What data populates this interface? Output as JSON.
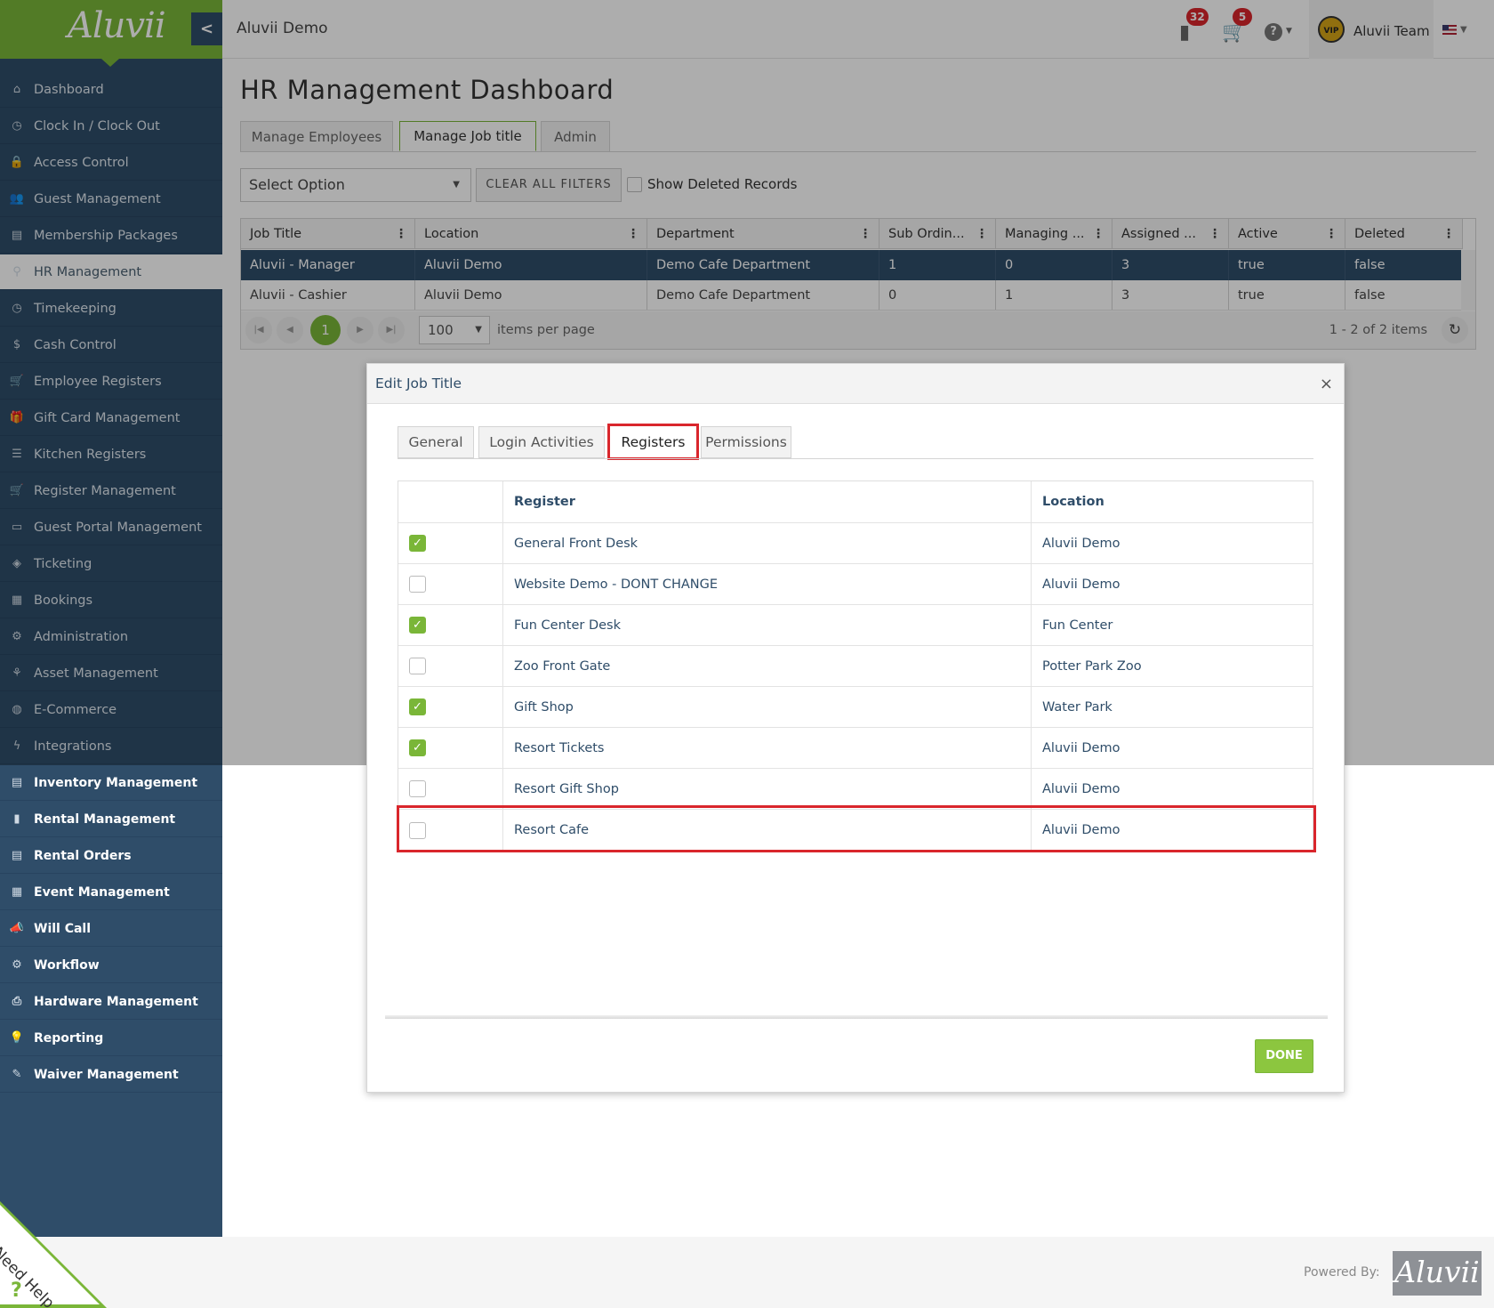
{
  "app": {
    "logo_text": "Aluvii",
    "collapse_icon": "chevron-left-icon"
  },
  "header": {
    "title": "Aluvii Demo",
    "notifications_count": "32",
    "cart_count": "5",
    "help_icon": "?",
    "user_name": "Aluvii Team",
    "avatar_text": "VIP"
  },
  "sidebar": {
    "items": [
      {
        "label": "Dashboard",
        "icon": "⌂"
      },
      {
        "label": "Clock In / Clock Out",
        "icon": "◷"
      },
      {
        "label": "Access Control",
        "icon": "🔒"
      },
      {
        "label": "Guest Management",
        "icon": "👥"
      },
      {
        "label": "Membership Packages",
        "icon": "▤"
      },
      {
        "label": "HR Management",
        "icon": "⚲"
      },
      {
        "label": "Timekeeping",
        "icon": "◷"
      },
      {
        "label": "Cash Control",
        "icon": "$"
      },
      {
        "label": "Employee Registers",
        "icon": "🛒"
      },
      {
        "label": "Gift Card Management",
        "icon": "🎁"
      },
      {
        "label": "Kitchen Registers",
        "icon": "☰"
      },
      {
        "label": "Register Management",
        "icon": "🛒"
      },
      {
        "label": "Guest Portal Management",
        "icon": "▭"
      },
      {
        "label": "Ticketing",
        "icon": "◈"
      },
      {
        "label": "Bookings",
        "icon": "▦"
      },
      {
        "label": "Administration",
        "icon": "⚙"
      },
      {
        "label": "Asset Management",
        "icon": "⚘"
      },
      {
        "label": "E-Commerce",
        "icon": "◍"
      },
      {
        "label": "Integrations",
        "icon": "ϟ"
      },
      {
        "label": "Inventory Management",
        "icon": "▤"
      },
      {
        "label": "Rental Management",
        "icon": "▮"
      },
      {
        "label": "Rental Orders",
        "icon": "▤"
      },
      {
        "label": "Event Management",
        "icon": "▦"
      },
      {
        "label": "Will Call",
        "icon": "📣"
      },
      {
        "label": "Workflow",
        "icon": "⚙"
      },
      {
        "label": "Hardware Management",
        "icon": "⎙"
      },
      {
        "label": "Reporting",
        "icon": "💡"
      },
      {
        "label": "Waiver Management",
        "icon": "✎"
      }
    ]
  },
  "page": {
    "title": "HR Management Dashboard",
    "tabs": [
      "Manage Employees",
      "Manage Job title",
      "Admin"
    ],
    "filter_select": "Select Option",
    "clear_filters": "CLEAR ALL FILTERS",
    "show_deleted": "Show Deleted Records"
  },
  "grid": {
    "columns": [
      "Job Title",
      "Location",
      "Department",
      "Sub Ordin...",
      "Managing ...",
      "Assigned ...",
      "Active",
      "Deleted"
    ],
    "rows": [
      [
        "Aluvii - Manager",
        "Aluvii Demo",
        "Demo Cafe Department",
        "1",
        "0",
        "3",
        "true",
        "false"
      ],
      [
        "Aluvii - Cashier",
        "Aluvii Demo",
        "Demo Cafe Department",
        "0",
        "1",
        "3",
        "true",
        "false"
      ]
    ],
    "current_page": "1",
    "page_size": "100",
    "items_per_page": "items per page",
    "count_text": "1 - 2 of 2 items"
  },
  "modal": {
    "title": "Edit Job Title",
    "close": "×",
    "tabs": [
      "General",
      "Login Activities",
      "Registers",
      "Permissions"
    ],
    "columns": {
      "register": "Register",
      "location": "Location"
    },
    "rows": [
      {
        "checked": true,
        "register": "General Front Desk",
        "location": "Aluvii Demo"
      },
      {
        "checked": false,
        "register": "Website Demo - DONT CHANGE",
        "location": "Aluvii Demo"
      },
      {
        "checked": true,
        "register": "Fun Center Desk",
        "location": "Fun Center"
      },
      {
        "checked": false,
        "register": "Zoo Front Gate",
        "location": "Potter Park Zoo"
      },
      {
        "checked": true,
        "register": "Gift Shop",
        "location": "Water Park"
      },
      {
        "checked": true,
        "register": "Resort Tickets",
        "location": "Aluvii Demo"
      },
      {
        "checked": false,
        "register": "Resort Gift Shop",
        "location": "Aluvii Demo"
      },
      {
        "checked": false,
        "register": "Resort Cafe",
        "location": "Aluvii Demo"
      }
    ],
    "done": "DONE"
  },
  "footer": {
    "powered_by": "Powered By:",
    "logo_text": "Aluvii",
    "need_help": "Need Help"
  },
  "colors": {
    "brand_green": "#7ab638",
    "sidebar_blue": "#2f4d69",
    "highlight_red": "#d9262c"
  }
}
